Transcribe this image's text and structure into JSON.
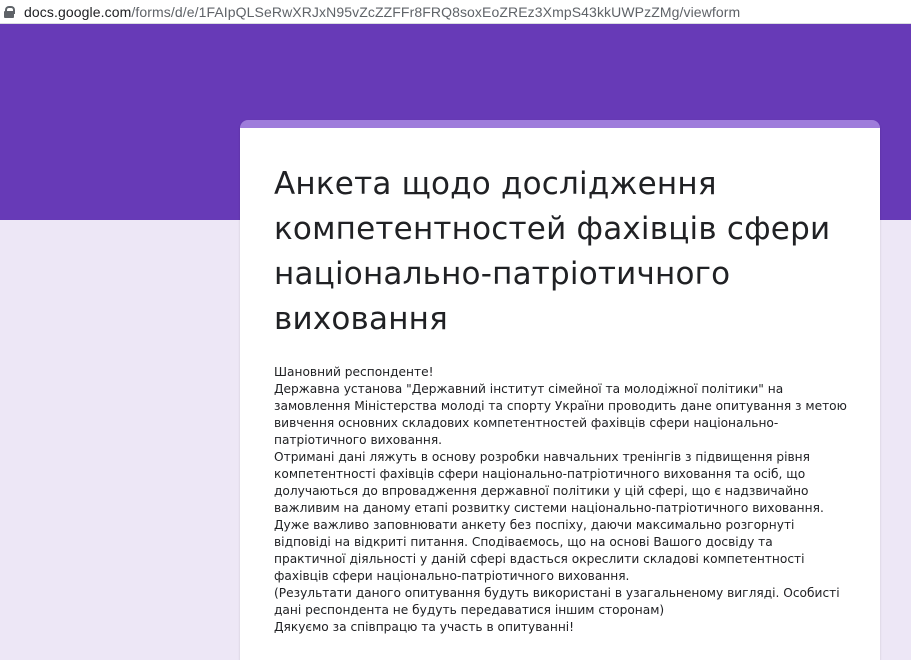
{
  "browser": {
    "url_host": "docs.google.com",
    "url_path": "/forms/d/e/1FAIpQLSeRwXRJxN95vZcZZFFr8FRQ8soxEoZREz3XmpS43kkUWPzZMg/viewform"
  },
  "theme": {
    "banner_color": "#673ab7",
    "accent_color": "#9e7cdb",
    "page_background": "#ede7f6"
  },
  "form": {
    "title": "Анкета щодо дослідження компетентностей фахівців сфери національно-патріотичного виховання",
    "description": [
      "Шановний респонденте!",
      "Державна установа \"Державний інститут сімейної та молодіжної політики\" на замовлення Міністерства молоді та спорту України проводить дане опитування з метою вивчення основних складових компетентностей фахівців сфери національно-патріотичного виховання.",
      "Отримані дані ляжуть в основу розробки навчальних тренінгів з підвищення рівня компетентності фахівців сфери національно-патріотичного виховання та осіб, що долучаються до впровадження державної політики у цій сфері, що є надзвичайно важливим на даному етапі розвитку системи національно-патріотичного виховання.",
      "Дуже важливо заповнювати анкету без поспіху, даючи максимально розгорнуті відповіді на відкриті питання. Сподіваємось, що на основі Вашого досвіду та практичної діяльності у даній сфері вдасться окреслити складові компетентності фахівців сфери національно-патріотичного виховання.",
      "(Результати даного опитування будуть використані в узагальненому вигляді. Особисті дані респондента не будуть передаватися іншим сторонам)",
      "Дякуємо за співпрацю та участь в опитуванні!"
    ]
  }
}
